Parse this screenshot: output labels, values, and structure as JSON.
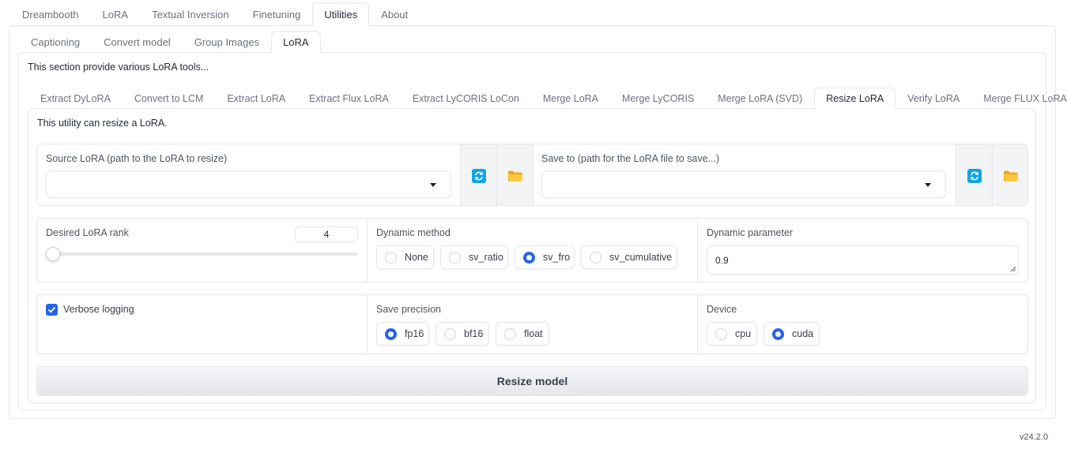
{
  "top_tabs": [
    "Dreambooth",
    "LoRA",
    "Textual Inversion",
    "Finetuning",
    "Utilities",
    "About"
  ],
  "top_active": 4,
  "utility_tabs": [
    "Captioning",
    "Convert model",
    "Group Images",
    "LoRA"
  ],
  "utility_active": 3,
  "section_description": "This section provide various LoRA tools...",
  "lora_tabs": [
    "Extract DyLoRA",
    "Convert to LCM",
    "Extract LoRA",
    "Extract Flux LoRA",
    "Extract LyCORIS LoCon",
    "Merge LoRA",
    "Merge LyCORIS",
    "Merge LoRA (SVD)",
    "Resize LoRA",
    "Verify LoRA",
    "Merge FLUX LoRA"
  ],
  "lora_active": 8,
  "utility_description": "This utility can resize a LoRA.",
  "source": {
    "label": "Source LoRA (path to the LoRA to resize)",
    "value": ""
  },
  "save_to": {
    "label": "Save to (path for the LoRA file to save...)",
    "value": ""
  },
  "rank": {
    "label": "Desired LoRA rank",
    "value": "4",
    "level": 0.0
  },
  "dynamic_method": {
    "label": "Dynamic method",
    "options": [
      "None",
      "sv_ratio",
      "sv_fro",
      "sv_cumulative"
    ],
    "selected": "sv_fro"
  },
  "dynamic_param": {
    "label": "Dynamic parameter",
    "value": "0.9"
  },
  "verbose": {
    "label": "Verbose logging",
    "checked": true
  },
  "precision": {
    "label": "Save precision",
    "options": [
      "fp16",
      "bf16",
      "float"
    ],
    "selected": "fp16"
  },
  "device": {
    "label": "Device",
    "options": [
      "cpu",
      "cuda"
    ],
    "selected": "cuda"
  },
  "submit_label": "Resize model",
  "version": "v24.2.0",
  "colors": {
    "accent": "#2563eb",
    "refresh": "#0ea5e9",
    "folder": "#f5b82e"
  }
}
